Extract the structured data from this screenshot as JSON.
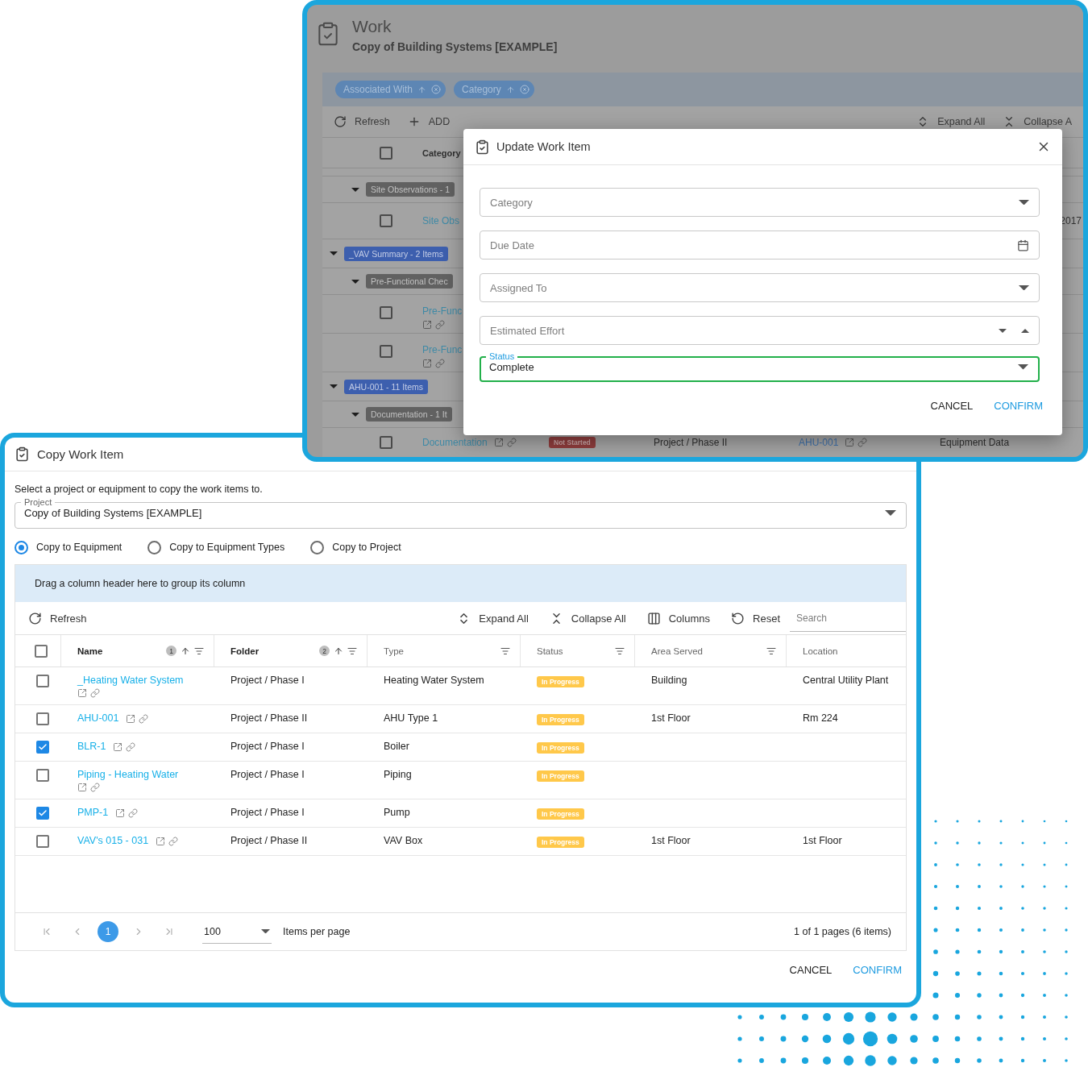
{
  "back_window": {
    "title": "Work",
    "subtitle": "Copy of Building Systems [EXAMPLE]",
    "group_chips": [
      {
        "label": "Associated With"
      },
      {
        "label": "Category"
      }
    ],
    "toolbar_left": [
      {
        "kind": "refresh",
        "label": "Refresh"
      },
      {
        "kind": "add",
        "label": "ADD"
      }
    ],
    "toolbar_right": [
      {
        "kind": "expand",
        "label": "Expand All"
      },
      {
        "kind": "collapse",
        "label": "Collapse A"
      }
    ],
    "grid_header": {
      "checked": false,
      "column_1": "Category"
    },
    "groups": [
      {
        "children": [
          {
            "label": "Site Observations - 1",
            "expanded": true,
            "rows": [
              {
                "kind": "inline",
                "checked": false,
                "name": "Site Obs",
                "column_last": "2017"
              }
            ]
          }
        ]
      },
      {
        "label": "_VAV Summary - 2 Items",
        "expanded": true,
        "children": [
          {
            "label": "Pre-Functional Chec",
            "expanded": true,
            "rows": [
              {
                "kind": "stacked",
                "checked": false,
                "name": "Pre-Func"
              },
              {
                "kind": "stacked",
                "checked": false,
                "name": "Pre-Func"
              }
            ]
          }
        ]
      },
      {
        "label": "AHU-001 - 11 Items",
        "expanded": true,
        "children": [
          {
            "label": "Documentation - 1 It",
            "expanded": true,
            "rows": [
              {
                "kind": "inline",
                "checked": false,
                "name": "Documentation",
                "status": {
                  "label": "Not Started",
                  "color": "#8e3d3d"
                },
                "folder": "Project / Phase II",
                "equipment": "AHU-001",
                "column_6": "Equipment Data"
              }
            ]
          }
        ]
      }
    ]
  },
  "update_dialog": {
    "title": "Update Work Item",
    "fields": [
      {
        "kind": "select",
        "placeholder": "Category"
      },
      {
        "kind": "date",
        "placeholder": "Due Date"
      },
      {
        "kind": "select",
        "placeholder": "Assigned To"
      },
      {
        "kind": "number",
        "placeholder": "Estimated Effort"
      },
      {
        "kind": "select",
        "label": "Status",
        "value": "Complete",
        "focused": true
      }
    ],
    "buttons": [
      {
        "kind": "plain",
        "label": "CANCEL"
      },
      {
        "kind": "primary",
        "label": "CONFIRM"
      }
    ]
  },
  "copy_dialog": {
    "title": "Copy Work Item",
    "instruction": "Select a project or equipment to copy the work items to.",
    "project_field": {
      "label": "Project",
      "value": "Copy of Building Systems [EXAMPLE]"
    },
    "copy_options": [
      {
        "label": "Copy to Equipment",
        "selected": true
      },
      {
        "label": "Copy to Equipment Types",
        "selected": false
      },
      {
        "label": "Copy to Project",
        "selected": false
      }
    ],
    "grid": {
      "group_panel_hint": "Drag a column header here to group its column",
      "toolbar_left": [
        {
          "kind": "refresh",
          "label": "Refresh"
        }
      ],
      "toolbar_right": [
        {
          "kind": "expand",
          "label": "Expand All"
        },
        {
          "kind": "collapse",
          "label": "Collapse All"
        },
        {
          "kind": "columns",
          "label": "Columns"
        },
        {
          "kind": "reset",
          "label": "Reset"
        }
      ],
      "search": {
        "placeholder": "Search"
      },
      "select_all_checked": false,
      "columns": [
        {
          "label": "Name",
          "sort_order": "1",
          "sorted": true,
          "filter": true
        },
        {
          "label": "Folder",
          "sort_order": "2",
          "sorted": true,
          "filter": true
        },
        {
          "label": "Type",
          "sorted": false,
          "filter": true
        },
        {
          "label": "Status",
          "sorted": false,
          "filter": true
        },
        {
          "label": "Area Served",
          "sorted": false,
          "filter": true
        },
        {
          "label": "Location",
          "sorted": false,
          "filter": false
        }
      ],
      "rows": [
        {
          "checked": false,
          "name": "_Heating Water System",
          "folder": "Project / Phase I",
          "type": "Heating Water System",
          "status": {
            "label": "In Progress",
            "color": "#ffc84a"
          },
          "area_served": "Building",
          "location": "Central Utility Plant"
        },
        {
          "checked": false,
          "name": "AHU-001",
          "folder": "Project / Phase II",
          "type": "AHU Type 1",
          "status": {
            "label": "In Progress",
            "color": "#ffc84a"
          },
          "area_served": "1st Floor",
          "location": "Rm 224"
        },
        {
          "checked": true,
          "name": "BLR-1",
          "folder": "Project / Phase I",
          "type": "Boiler",
          "status": {
            "label": "In Progress",
            "color": "#ffc84a"
          }
        },
        {
          "checked": false,
          "name": "Piping - Heating Water",
          "folder": "Project / Phase I",
          "type": "Piping",
          "status": {
            "label": "In Progress",
            "color": "#ffc84a"
          }
        },
        {
          "checked": true,
          "name": "PMP-1",
          "folder": "Project / Phase I",
          "type": "Pump",
          "status": {
            "label": "In Progress",
            "color": "#ffc84a"
          }
        },
        {
          "checked": false,
          "name": "VAV's 015 - 031",
          "folder": "Project / Phase II",
          "type": "VAV Box",
          "status": {
            "label": "In Progress",
            "color": "#ffc84a"
          },
          "area_served": "1st Floor",
          "location": "1st Floor"
        }
      ],
      "pager": {
        "nav_disabled": true,
        "pages": [
          {
            "label": "1",
            "selected": true
          }
        ],
        "page_size": "100",
        "page_size_label": "Items per page",
        "summary": "1 of 1 pages (6 items)"
      }
    },
    "buttons": [
      {
        "kind": "plain",
        "label": "CANCEL"
      },
      {
        "kind": "primary",
        "label": "CONFIRM"
      }
    ]
  }
}
